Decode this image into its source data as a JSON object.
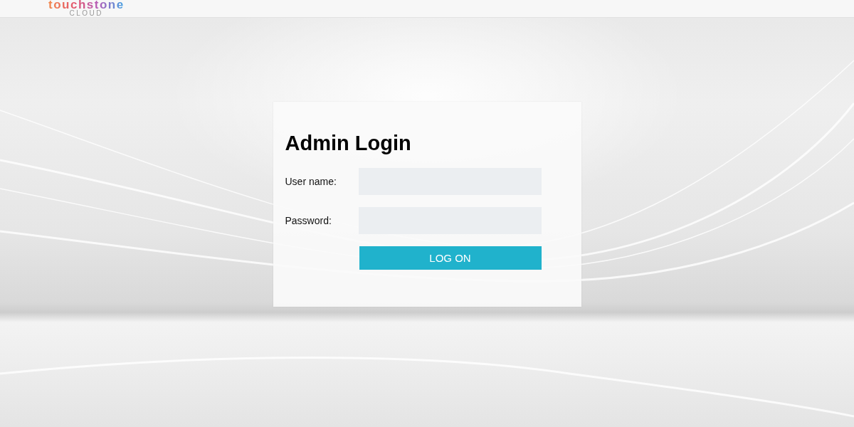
{
  "header": {
    "logo": {
      "wordmark": "touchstone",
      "subtitle": "CLOUD"
    }
  },
  "login": {
    "title": "Admin Login",
    "fields": [
      {
        "label": "User name:"
      },
      {
        "label": "Password:"
      }
    ],
    "submit": {
      "label": "LOG ON"
    }
  }
}
